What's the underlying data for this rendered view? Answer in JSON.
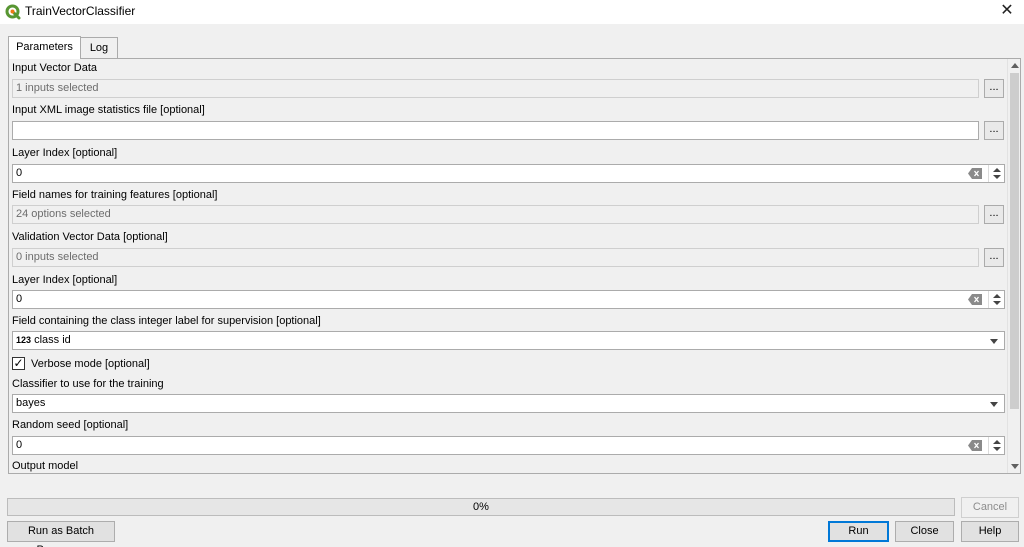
{
  "window": {
    "title": "TrainVectorClassifier",
    "close_label": "✕"
  },
  "tabs": [
    {
      "label": "Parameters",
      "active": true
    },
    {
      "label": "Log",
      "active": false
    }
  ],
  "parameters": {
    "input_vector_data": {
      "label": "Input Vector Data",
      "value": "1 inputs selected",
      "browse_label": "..."
    },
    "xml_stats": {
      "label": "Input XML image statistics file [optional]",
      "value": "",
      "browse_label": "..."
    },
    "layer_index_1": {
      "label": "Layer Index [optional]",
      "value": "0"
    },
    "field_names": {
      "label": "Field names for training features [optional]",
      "value": "24 options selected",
      "browse_label": "..."
    },
    "validation_vector": {
      "label": "Validation Vector Data [optional]",
      "value": "0 inputs selected",
      "browse_label": "..."
    },
    "layer_index_2": {
      "label": "Layer Index [optional]",
      "value": "0"
    },
    "class_field": {
      "label": "Field containing the class integer label for supervision [optional]",
      "type_badge": "123",
      "value": "class id"
    },
    "verbose": {
      "label": "Verbose mode [optional]",
      "checked": true,
      "check_glyph": "✓"
    },
    "classifier": {
      "label": "Classifier to use for the training",
      "value": "bayes"
    },
    "random_seed": {
      "label": "Random seed [optional]",
      "value": "0"
    },
    "output_model": {
      "label": "Output model"
    }
  },
  "progress": {
    "percent": 0,
    "text": "0%"
  },
  "buttons": {
    "cancel": "Cancel",
    "batch": "Run as Batch Process...",
    "run": "Run",
    "close": "Close",
    "help": "Help"
  },
  "colors": {
    "accent": "#0078d7",
    "qgis_green": "#589632",
    "progress_fill": "#06b025"
  }
}
